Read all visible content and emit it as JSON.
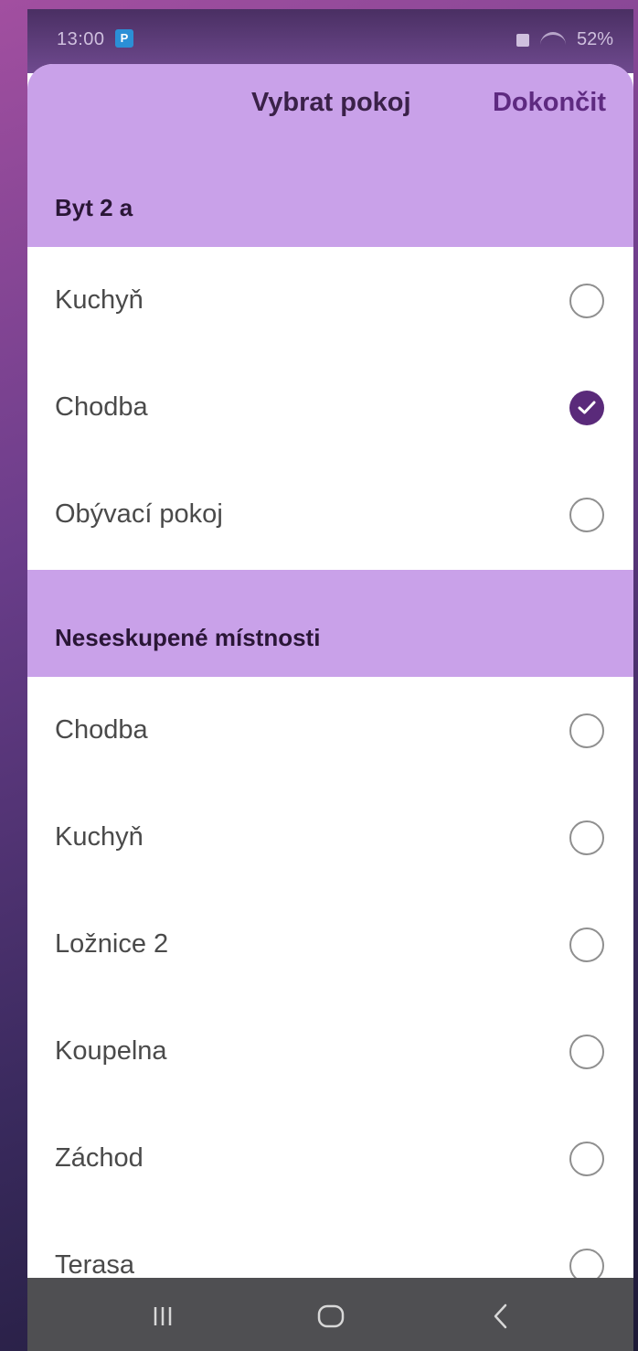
{
  "status_bar": {
    "time": "13:00",
    "app_icon_letter": "P",
    "battery": "52%"
  },
  "header": {
    "title": "Vybrat pokoj",
    "done_label": "Dokončit"
  },
  "sections": [
    {
      "label": "Byt 2 a",
      "rooms": [
        {
          "label": "Kuchyň",
          "checked": false
        },
        {
          "label": "Chodba",
          "checked": true
        },
        {
          "label": "Obývací pokoj",
          "checked": false
        }
      ]
    },
    {
      "label": "Neseskupené místnosti",
      "rooms": [
        {
          "label": "Chodba",
          "checked": false
        },
        {
          "label": "Kuchyň",
          "checked": false
        },
        {
          "label": "Ložnice 2",
          "checked": false
        },
        {
          "label": "Koupelna",
          "checked": false
        },
        {
          "label": "Záchod",
          "checked": false
        },
        {
          "label": "Terasa",
          "checked": false
        }
      ]
    }
  ],
  "nav_bar": {
    "buttons": [
      "recents-icon",
      "home-icon",
      "back-icon"
    ]
  },
  "colors": {
    "header_bg": "#c9a1e9",
    "accent": "#5a2a7a",
    "nav_bg": "#4f4f52"
  }
}
